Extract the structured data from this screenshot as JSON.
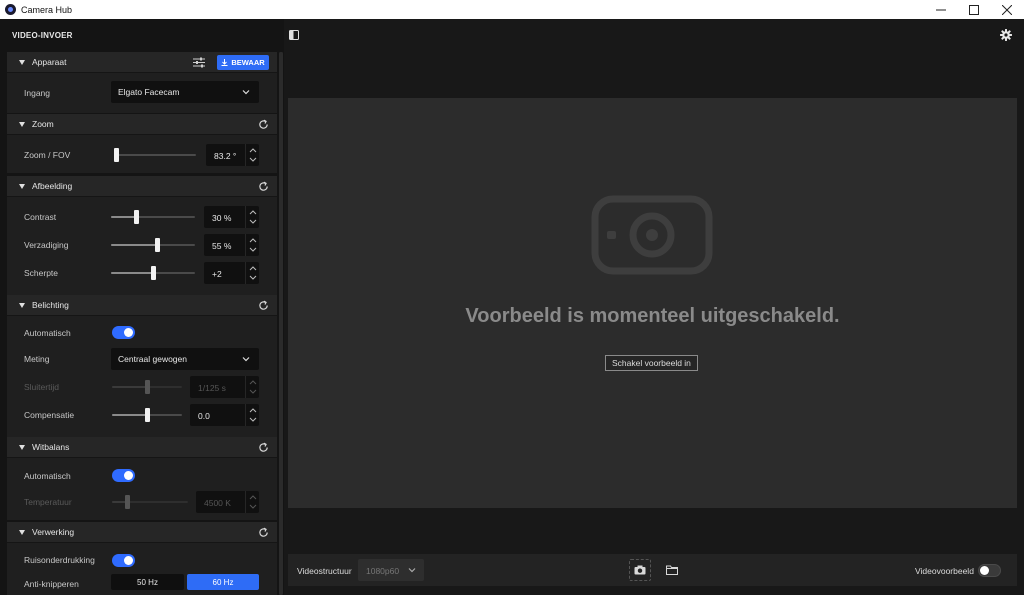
{
  "window": {
    "title": "Camera Hub",
    "controls": {
      "minimize": "—",
      "maximize": "☐",
      "close": "✕"
    }
  },
  "left_panel": {
    "header": "VIDEO-INVOER",
    "sections": {
      "apparaat": {
        "title": "Apparaat",
        "save_label": "BEWAAR",
        "input_label": "Ingang",
        "input_value": "Elgato Facecam"
      },
      "zoom": {
        "title": "Zoom",
        "fov_label": "Zoom / FOV",
        "fov_value": "83.2 °",
        "fov_level": 0.02
      },
      "afbeelding": {
        "title": "Afbeelding",
        "contrast_label": "Contrast",
        "contrast_value": "30 %",
        "contrast_level": 0.3,
        "saturation_label": "Verzadiging",
        "saturation_value": "55 %",
        "saturation_level": 0.55,
        "sharpness_label": "Scherpte",
        "sharpness_value": "+2",
        "sharpness_level": 0.5
      },
      "belichting": {
        "title": "Belichting",
        "auto_label": "Automatisch",
        "auto_on": true,
        "metering_label": "Meting",
        "metering_value": "Centraal gewogen",
        "shutter_label": "Sluitertijd",
        "shutter_value": "1/125 s",
        "shutter_level": 0.5,
        "comp_label": "Compensatie",
        "comp_value": "0.0",
        "comp_level": 0.5
      },
      "witbalans": {
        "title": "Witbalans",
        "auto_label": "Automatisch",
        "auto_on": true,
        "temp_label": "Temperatuur",
        "temp_value": "4500 K",
        "temp_level": 0.2
      },
      "verwerking": {
        "title": "Verwerking",
        "noise_label": "Ruisonderdrukking",
        "noise_on": true,
        "flicker_label": "Anti-knipperen",
        "flicker_options": [
          "50 Hz",
          "60 Hz"
        ],
        "flicker_selected": "60 Hz"
      }
    }
  },
  "preview": {
    "message": "Voorbeeld is momenteel uitgeschakeld.",
    "enable_button": "Schakel voorbeeld in"
  },
  "bottom_bar": {
    "format_label": "Videostructuur",
    "format_value": "1080p60",
    "preview_toggle_label": "Videovoorbeeld",
    "preview_toggle_on": false
  },
  "colors": {
    "accent": "#2e6cf6",
    "toggle_on": "#2f6bff",
    "panel": "#1f1f1f",
    "preview_bg": "#2c2c2c"
  },
  "icons": [
    "app-logo-icon",
    "sidebar-toggle-icon",
    "settings-gear-icon",
    "tune-sliders-icon",
    "download-icon",
    "reset-icon",
    "chevron-down-icon",
    "camera-placeholder-icon",
    "snapshot-camera-icon",
    "folder-icon"
  ]
}
